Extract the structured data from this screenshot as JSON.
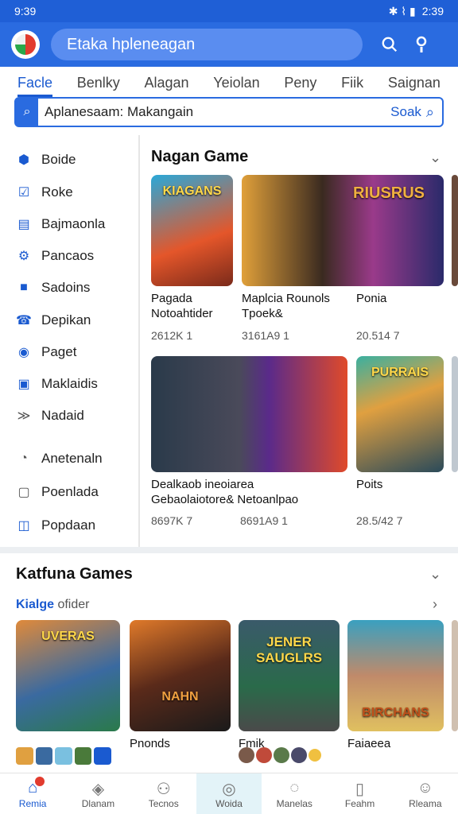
{
  "status": {
    "time": "9:39",
    "right": "2:39"
  },
  "header": {
    "title": "Etaka hpleneagan"
  },
  "tabs": [
    {
      "label": "Facle"
    },
    {
      "label": "Benlky"
    },
    {
      "label": "Alagan"
    },
    {
      "label": "Yeiolan"
    },
    {
      "label": "Peny"
    },
    {
      "label": "Fiik"
    },
    {
      "label": "Saignan"
    }
  ],
  "search": {
    "value": "Aplanesaam: Makangain",
    "button": "Soak"
  },
  "sidebar": {
    "items": [
      {
        "label": "Boide"
      },
      {
        "label": "Roke"
      },
      {
        "label": "Bajmaonla"
      },
      {
        "label": "Pancaos"
      },
      {
        "label": "Sadoins"
      },
      {
        "label": "Depikan"
      },
      {
        "label": "Paget"
      },
      {
        "label": "Maklaidis"
      },
      {
        "label": "Nadaid"
      },
      {
        "label": "Anetenaln"
      },
      {
        "label": "Poenlada"
      },
      {
        "label": "Popdaan"
      }
    ]
  },
  "nagan": {
    "title": "Nagan Game",
    "row1": [
      {
        "art": "KIAGANS",
        "t1": "Pagada",
        "t2": "Notoahtider",
        "num": "2612K 1"
      },
      {
        "art": "RIUSRUS",
        "t1": "Maplcia Rounols",
        "t2": "Tpoek&",
        "num": "3161A9 1"
      },
      {
        "art": "",
        "t1": "Ponia",
        "t2": "",
        "num": "20.514 7"
      }
    ],
    "row2": [
      {
        "art": "",
        "t1": "Dealkaob ineoiarea",
        "t2": "Gebaolaiotore& Netoanlpao",
        "num": "8697K 7"
      },
      {
        "art": "",
        "t1": "",
        "t2": "",
        "num": "8691A9 1"
      },
      {
        "art": "PURRAIS",
        "t1": "Poits",
        "t2": "",
        "num": "28.5/42 7"
      }
    ]
  },
  "featured": {
    "title": "Katfuna Games",
    "subtitle": "Kialge",
    "subtitle_rest": " ofider",
    "cards": [
      {
        "art": "UVERAS",
        "t": ""
      },
      {
        "art": "NAHN",
        "t": "Pnonds"
      },
      {
        "art": "JENER SAUGLRS",
        "t": "Fmik"
      },
      {
        "art": "BIRCHANS",
        "t": "Faiaeea"
      }
    ]
  },
  "bottomnav": [
    {
      "label": "Remia"
    },
    {
      "label": "Dlanam"
    },
    {
      "label": "Tecnos"
    },
    {
      "label": "Woida"
    },
    {
      "label": "Manelas"
    },
    {
      "label": "Feahm"
    },
    {
      "label": "Rleama"
    }
  ],
  "colors": {
    "primary": "#2a6be0",
    "accent": "#1a5ad0"
  }
}
